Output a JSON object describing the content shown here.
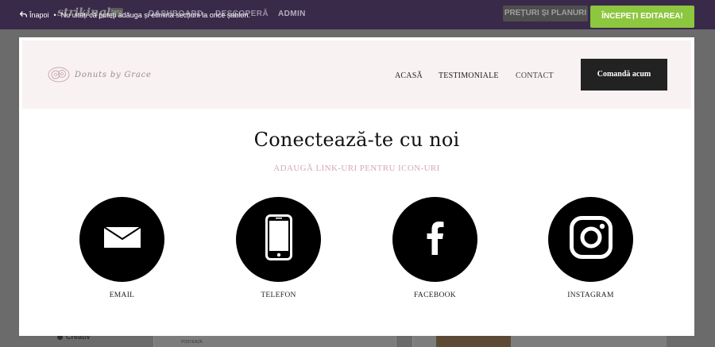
{
  "app": {
    "logo": "strikingly",
    "logo_badge": "beta",
    "nav": [
      "DASHBOARD",
      "DESCOPERĂ",
      "ADMIN"
    ],
    "pricing_label": "PREȚURI ȘI PLANURI",
    "sidebar_item": "Creativ",
    "panel_text": "POSTEAZĂ"
  },
  "overlay": {
    "back_label": "Înapoi",
    "separator": "•",
    "notice": "Nu uitați că puteți adăuga și elimina secțiuni la orice șablon.",
    "start_button": "ÎNCEPEȚI EDITAREA!",
    "accent_color": "#8dc63f"
  },
  "site": {
    "logo_text": "Donuts by Grace",
    "nav": {
      "home": "ACASĂ",
      "testimonials": "TESTIMONIALE",
      "contact": "CONTACT"
    },
    "order_button": "Comandă acum",
    "header_bg": "#f8f2f2"
  },
  "section": {
    "title": "Conectează-te cu noi",
    "subtitle": "ADAUGĂ LINK-URI PENTRU ICON-URI",
    "subtitle_color": "#d4a8bc",
    "items": [
      {
        "label": "EMAIL",
        "icon": "envelope-icon"
      },
      {
        "label": "TELEFON",
        "icon": "phone-icon"
      },
      {
        "label": "FACEBOOK",
        "icon": "facebook-icon"
      },
      {
        "label": "INSTAGRAM",
        "icon": "instagram-icon"
      }
    ]
  }
}
